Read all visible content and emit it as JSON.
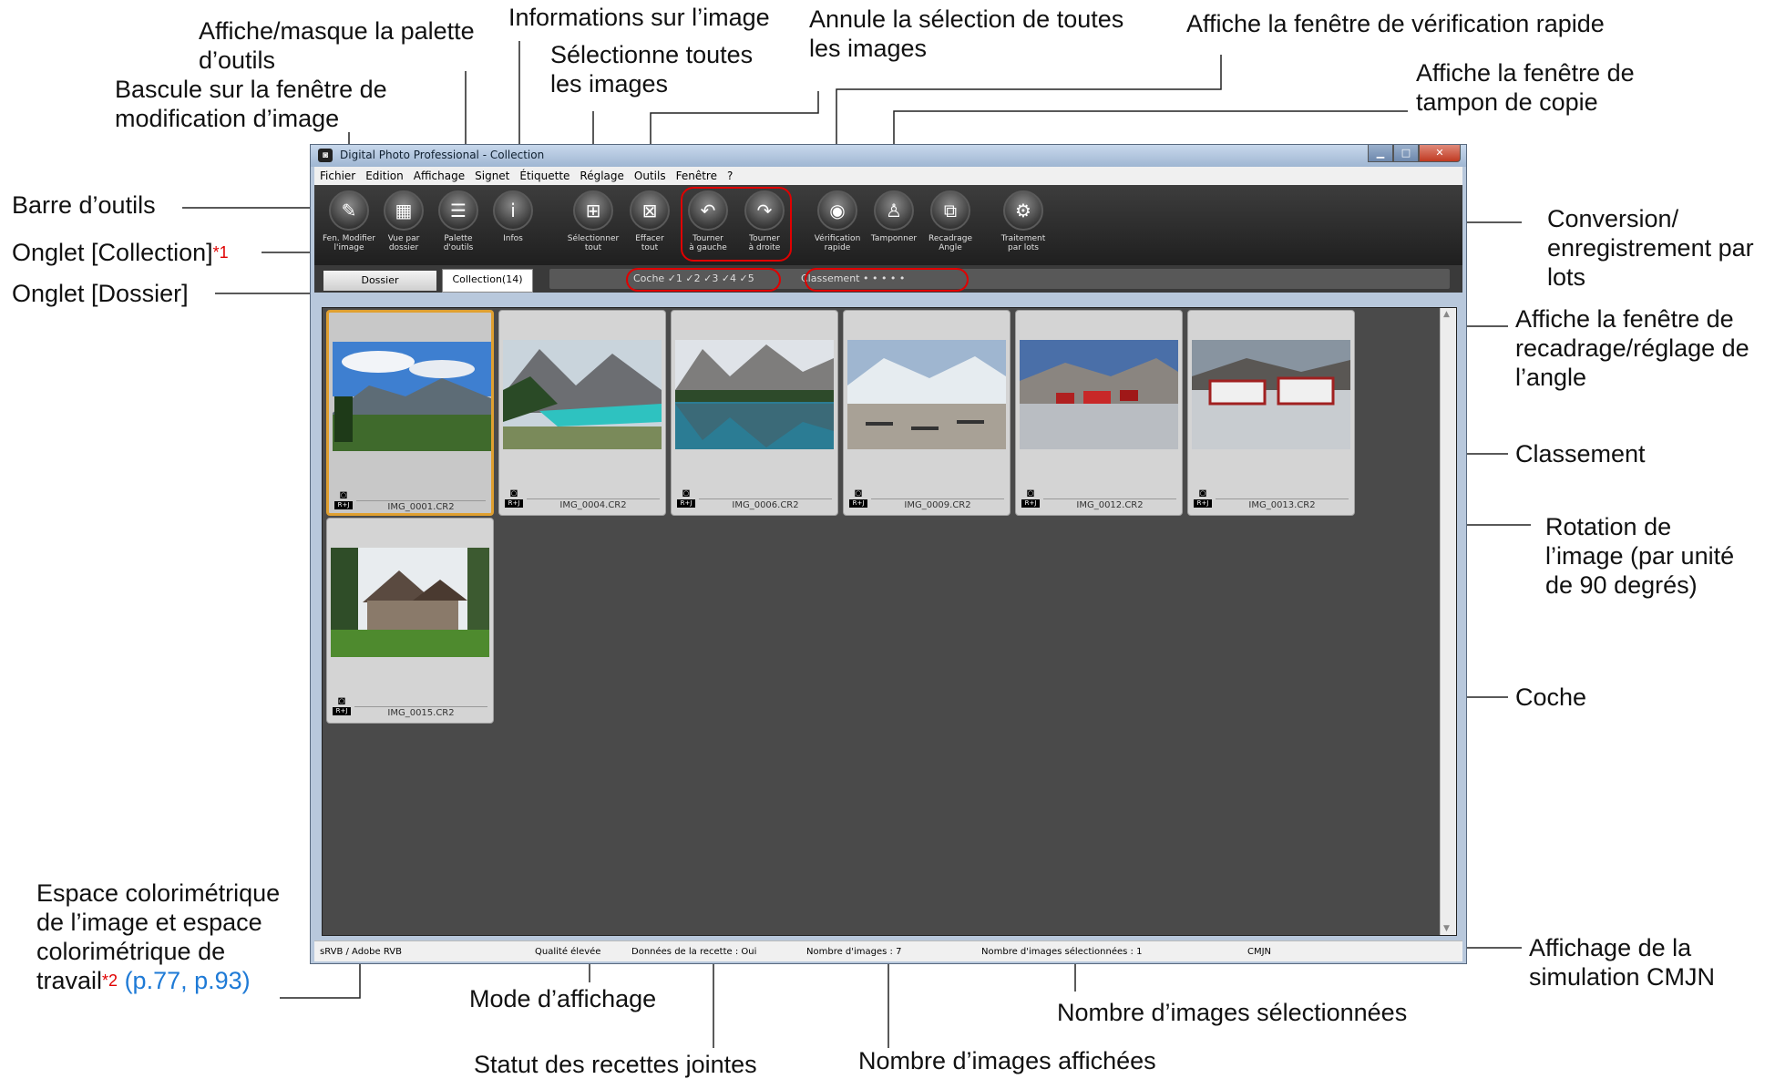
{
  "window": {
    "title": "Digital Photo Professional - Collection",
    "controls": {
      "minimize": "▁",
      "maximize": "□",
      "close": "✕"
    }
  },
  "menu": [
    "Fichier",
    "Edition",
    "Affichage",
    "Signet",
    "Étiquette",
    "Réglage",
    "Outils",
    "Fenêtre",
    "?"
  ],
  "toolbar": [
    {
      "label": "Fen. Modifier\nl'image",
      "icon": "edit-image-icon",
      "glyph": "✎"
    },
    {
      "label": "Vue par\ndossier",
      "icon": "folder-view-icon",
      "glyph": "▦"
    },
    {
      "label": "Palette\nd'outils",
      "icon": "tool-palette-icon",
      "glyph": "☰"
    },
    {
      "label": "Infos",
      "icon": "info-icon",
      "glyph": "i"
    },
    {
      "label": "Sélectionner\ntout",
      "icon": "select-all-icon",
      "glyph": "⊞"
    },
    {
      "label": "Effacer\ntout",
      "icon": "clear-all-icon",
      "glyph": "⊠"
    },
    {
      "label": "Tourner\nà gauche",
      "icon": "rotate-left-icon",
      "glyph": "↶"
    },
    {
      "label": "Tourner\nà droite",
      "icon": "rotate-right-icon",
      "glyph": "↷"
    },
    {
      "label": "Vérification\nrapide",
      "icon": "quick-check-icon",
      "glyph": "◉"
    },
    {
      "label": "Tamponner",
      "icon": "stamp-icon",
      "glyph": "♙"
    },
    {
      "label": "Recadrage\nAngle",
      "icon": "crop-angle-icon",
      "glyph": "⧉"
    },
    {
      "label": "Traitement\npar lots",
      "icon": "batch-process-icon",
      "glyph": "⚙"
    }
  ],
  "tabs": {
    "dossier": "Dossier",
    "collection": "Collection(14)"
  },
  "filter": {
    "coche": "Coche  ✓1 ✓2 ✓3 ✓4 ✓5",
    "classement": "Classement  •  •  •  •  •"
  },
  "images": [
    {
      "name": "IMG_0001.CR2",
      "selected": true,
      "badge": "R+J"
    },
    {
      "name": "IMG_0004.CR2",
      "selected": false,
      "badge": "R+J"
    },
    {
      "name": "IMG_0006.CR2",
      "selected": false,
      "badge": "R+J"
    },
    {
      "name": "IMG_0009.CR2",
      "selected": false,
      "badge": "R+J"
    },
    {
      "name": "IMG_0012.CR2",
      "selected": false,
      "badge": "R+J"
    },
    {
      "name": "IMG_0013.CR2",
      "selected": false,
      "badge": "R+J"
    },
    {
      "name": "IMG_0015.CR2",
      "selected": false,
      "badge": "R+J"
    }
  ],
  "statusbar": {
    "colorspace": "sRVB / Adobe RVB",
    "quality": "Qualité élevée",
    "recipe": "Données de la recette : Oui",
    "count": "Nombre d'images : 7",
    "selected": "Nombre d'images sélectionnées : 1",
    "cmyk": "CMJN"
  },
  "callouts": {
    "affiche_masque": "Affiche/masque la palette",
    "affiche_masque2": "d’outils",
    "bascule1": "Bascule sur la fenêtre de",
    "bascule2": "modification d’image",
    "infos_image": "Informations sur l’image",
    "selectionne1": "Sélectionne toutes",
    "selectionne2": "les images",
    "annule1": "Annule la sélection de toutes",
    "annule2": "les images",
    "verif_rapide": "Affiche la fenêtre de vérification rapide",
    "tampon1": "Affiche la fenêtre de",
    "tampon2": "tampon de copie",
    "barre_outils": "Barre d’outils",
    "onglet_collection": "Onglet [Collection]",
    "note1": "*1",
    "onglet_dossier": "Onglet [Dossier]",
    "conversion1": "Conversion/",
    "conversion2": "enregistrement par",
    "conversion3": "lots",
    "recadrage1": "Affiche la fenêtre de",
    "recadrage2": "recadrage/réglage de",
    "recadrage3": "l’angle",
    "classement": "Classement",
    "rotation1": "Rotation de",
    "rotation2": "l’image (par unité",
    "rotation3": "de 90 degrés)",
    "coche": "Coche",
    "espace1": "Espace colorimétrique",
    "espace2": "de l’image et espace",
    "espace3": "colorimétrique de",
    "espace4": "travail",
    "note2": "*2",
    "pages": "(p.77, p.93)",
    "mode": "Mode d’affichage",
    "statut": "Statut des recettes jointes",
    "nb_affichees": "Nombre d’images affichées",
    "nb_selectionnees": "Nombre d’images sélectionnées",
    "cmjn1": "Affichage de la",
    "cmjn2": "simulation CMJN"
  },
  "colors": {
    "annotation_red": "#e00000",
    "link_blue": "#1e7ad6",
    "toolbar_bg": "#2a2a2a",
    "selection_orange": "#e0a030"
  }
}
